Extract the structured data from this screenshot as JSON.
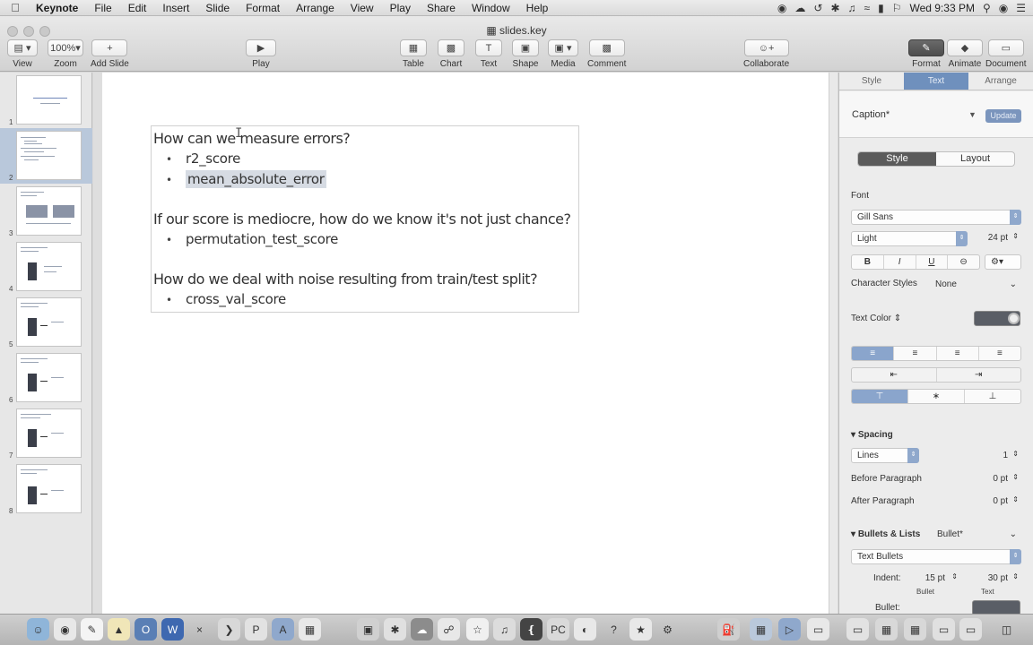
{
  "menubar": {
    "items": [
      "Keynote",
      "File",
      "Edit",
      "Insert",
      "Slide",
      "Format",
      "Arrange",
      "View",
      "Play",
      "Share",
      "Window",
      "Help"
    ],
    "clock": "Wed 9:33 PM"
  },
  "window": {
    "title": "slides.key"
  },
  "toolbar": {
    "view_label": "View",
    "zoom_value": "100%",
    "zoom_label": "Zoom",
    "add_slide_label": "Add Slide",
    "play_label": "Play",
    "table_label": "Table",
    "chart_label": "Chart",
    "text_label": "Text",
    "shape_label": "Shape",
    "media_label": "Media",
    "comment_label": "Comment",
    "collaborate_label": "Collaborate",
    "format_label": "Format",
    "animate_label": "Animate",
    "document_label": "Document"
  },
  "navigator": {
    "slide_numbers": [
      "1",
      "2",
      "3",
      "4",
      "5",
      "6",
      "7",
      "8"
    ],
    "selected_index": 2
  },
  "slide": {
    "q1": "How can we measure errors?",
    "b1": "r2_score",
    "b2": "mean_absolute_error",
    "q2": "If our score is mediocre, how do we know it's not just chance?",
    "b3": "permutation_test_score",
    "q3": "How do we deal with noise resulting from train/test split?",
    "b4": "cross_val_score",
    "bullet_glyph": "•"
  },
  "inspector": {
    "tabs": [
      "Style",
      "Text",
      "Arrange"
    ],
    "active_tab": "Text",
    "paragraph_style": "Caption*",
    "update_label": "Update",
    "subtabs": [
      "Style",
      "Layout"
    ],
    "font_label": "Font",
    "font_family": "Gill Sans",
    "font_weight": "Light",
    "font_size": "24 pt",
    "bold": "B",
    "italic": "I",
    "underline": "U",
    "character_styles_label": "Character Styles",
    "character_styles_value": "None",
    "text_color_label": "Text Color",
    "spacing_label": "Spacing",
    "spacing_mode": "Lines",
    "spacing_value": "1",
    "before_paragraph_label": "Before Paragraph",
    "before_paragraph_value": "0 pt",
    "after_paragraph_label": "After Paragraph",
    "after_paragraph_value": "0 pt",
    "bullets_label": "Bullets & Lists",
    "bullets_value": "Bullet*",
    "bullet_type": "Text Bullets",
    "indent_label": "Indent:",
    "indent_bullet": "15 pt",
    "indent_text": "30 pt",
    "indent_bullet_caption": "Bullet",
    "indent_text_caption": "Text",
    "bullet_field_label": "Bullet:"
  },
  "colors": {
    "accent": "#6f90bd",
    "selection_highlight": "#d6dbe3",
    "selected_thumb": "#b9c8db"
  }
}
